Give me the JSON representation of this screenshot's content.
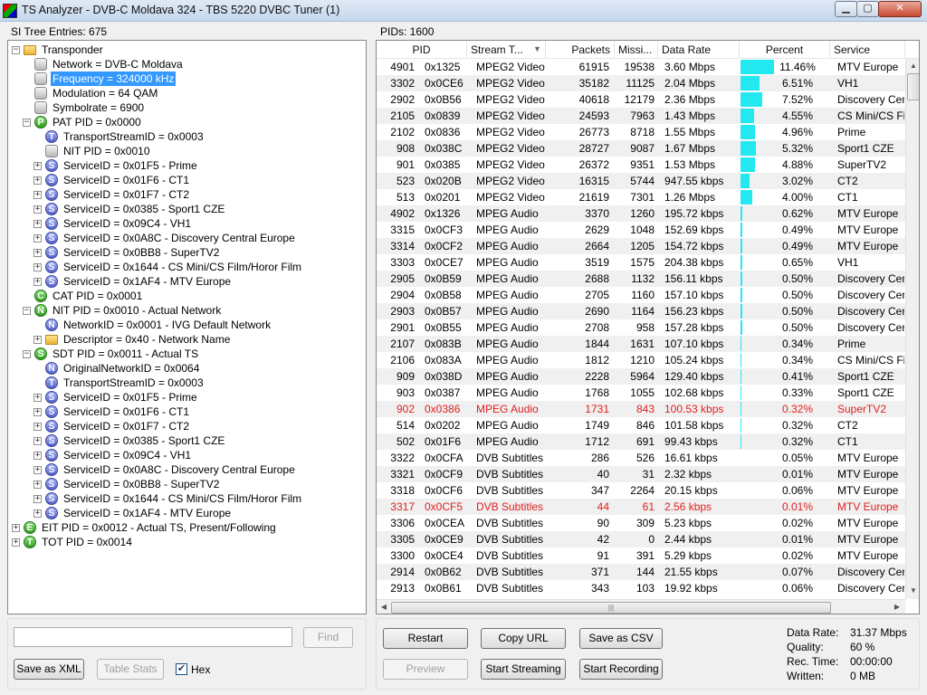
{
  "window": {
    "title": "TS Analyzer - DVB-C Moldava 324 - TBS 5220 DVBC Tuner (1)",
    "min": "▁",
    "max": "▢",
    "close": "✕"
  },
  "left": {
    "label": "SI Tree Entries: 675"
  },
  "right": {
    "label": "PIDs: 1600"
  },
  "tree": [
    {
      "lvl": 0,
      "exp": "−",
      "icon": "folder",
      "g": "",
      "text": "Transponder"
    },
    {
      "lvl": 1,
      "exp": "",
      "icon": "gray",
      "g": "",
      "text": "Network = DVB-C Moldava"
    },
    {
      "lvl": 1,
      "exp": "",
      "icon": "gray",
      "g": "",
      "text": "Frequency = 324000 kHz",
      "sel": true
    },
    {
      "lvl": 1,
      "exp": "",
      "icon": "gray",
      "g": "",
      "text": "Modulation = 64 QAM"
    },
    {
      "lvl": 1,
      "exp": "",
      "icon": "gray",
      "g": "",
      "text": "Symbolrate = 6900"
    },
    {
      "lvl": 1,
      "exp": "−",
      "icon": "green",
      "g": "P",
      "text": "PAT PID = 0x0000"
    },
    {
      "lvl": 2,
      "exp": "",
      "icon": "blue",
      "g": "T",
      "text": "TransportStreamID = 0x0003"
    },
    {
      "lvl": 2,
      "exp": "",
      "icon": "gray",
      "g": "",
      "text": "NIT PID = 0x0010"
    },
    {
      "lvl": 2,
      "exp": "+",
      "icon": "blue",
      "g": "S",
      "text": "ServiceID = 0x01F5 - Prime"
    },
    {
      "lvl": 2,
      "exp": "+",
      "icon": "blue",
      "g": "S",
      "text": "ServiceID = 0x01F6 - CT1"
    },
    {
      "lvl": 2,
      "exp": "+",
      "icon": "blue",
      "g": "S",
      "text": "ServiceID = 0x01F7 - CT2"
    },
    {
      "lvl": 2,
      "exp": "+",
      "icon": "blue",
      "g": "S",
      "text": "ServiceID = 0x0385 - Sport1 CZE"
    },
    {
      "lvl": 2,
      "exp": "+",
      "icon": "blue",
      "g": "S",
      "text": "ServiceID = 0x09C4 - VH1"
    },
    {
      "lvl": 2,
      "exp": "+",
      "icon": "blue",
      "g": "S",
      "text": "ServiceID = 0x0A8C - Discovery Central Europe"
    },
    {
      "lvl": 2,
      "exp": "+",
      "icon": "blue",
      "g": "S",
      "text": "ServiceID = 0x0BB8 - SuperTV2"
    },
    {
      "lvl": 2,
      "exp": "+",
      "icon": "blue",
      "g": "S",
      "text": "ServiceID = 0x1644 - CS Mini/CS Film/Horor Film"
    },
    {
      "lvl": 2,
      "exp": "+",
      "icon": "blue",
      "g": "S",
      "text": "ServiceID = 0x1AF4 - MTV Europe"
    },
    {
      "lvl": 1,
      "exp": "",
      "icon": "green",
      "g": "C",
      "text": "CAT PID = 0x0001"
    },
    {
      "lvl": 1,
      "exp": "−",
      "icon": "green",
      "g": "N",
      "text": "NIT PID = 0x0010 - Actual Network"
    },
    {
      "lvl": 2,
      "exp": "",
      "icon": "blue",
      "g": "N",
      "text": "NetworkID = 0x0001 - IVG Default Network"
    },
    {
      "lvl": 2,
      "exp": "+",
      "icon": "folder",
      "g": "",
      "text": "Descriptor = 0x40 - Network Name"
    },
    {
      "lvl": 1,
      "exp": "−",
      "icon": "green",
      "g": "S",
      "text": "SDT PID = 0x0011 - Actual TS"
    },
    {
      "lvl": 2,
      "exp": "",
      "icon": "blue",
      "g": "N",
      "text": "OriginalNetworkID = 0x0064"
    },
    {
      "lvl": 2,
      "exp": "",
      "icon": "blue",
      "g": "T",
      "text": "TransportStreamID = 0x0003"
    },
    {
      "lvl": 2,
      "exp": "+",
      "icon": "blue",
      "g": "S",
      "text": "ServiceID = 0x01F5 - Prime"
    },
    {
      "lvl": 2,
      "exp": "+",
      "icon": "blue",
      "g": "S",
      "text": "ServiceID = 0x01F6 - CT1"
    },
    {
      "lvl": 2,
      "exp": "+",
      "icon": "blue",
      "g": "S",
      "text": "ServiceID = 0x01F7 - CT2"
    },
    {
      "lvl": 2,
      "exp": "+",
      "icon": "blue",
      "g": "S",
      "text": "ServiceID = 0x0385 - Sport1 CZE"
    },
    {
      "lvl": 2,
      "exp": "+",
      "icon": "blue",
      "g": "S",
      "text": "ServiceID = 0x09C4 - VH1"
    },
    {
      "lvl": 2,
      "exp": "+",
      "icon": "blue",
      "g": "S",
      "text": "ServiceID = 0x0A8C - Discovery Central Europe"
    },
    {
      "lvl": 2,
      "exp": "+",
      "icon": "blue",
      "g": "S",
      "text": "ServiceID = 0x0BB8 - SuperTV2"
    },
    {
      "lvl": 2,
      "exp": "+",
      "icon": "blue",
      "g": "S",
      "text": "ServiceID = 0x1644 - CS Mini/CS Film/Horor Film"
    },
    {
      "lvl": 2,
      "exp": "+",
      "icon": "blue",
      "g": "S",
      "text": "ServiceID = 0x1AF4 - MTV Europe"
    },
    {
      "lvl": 0,
      "exp": "+",
      "icon": "green",
      "g": "E",
      "text": "EIT PID = 0x0012 - Actual TS, Present/Following"
    },
    {
      "lvl": 0,
      "exp": "+",
      "icon": "green",
      "g": "T",
      "text": "TOT PID = 0x0014"
    }
  ],
  "columns": [
    "PID",
    "Stream T...",
    "Packets",
    "Missi...",
    "Data Rate",
    "Percent",
    "Service"
  ],
  "rows": [
    {
      "pid": "4901",
      "hex": "0x1325",
      "type": "MPEG2 Video",
      "packets": "61915",
      "missing": "19538",
      "rate": "3.60 Mbps",
      "percent": "11.46%",
      "pct": 11.46,
      "service": "MTV Europe",
      "red": false
    },
    {
      "pid": "3302",
      "hex": "0x0CE6",
      "type": "MPEG2 Video",
      "packets": "35182",
      "missing": "11125",
      "rate": "2.04 Mbps",
      "percent": "6.51%",
      "pct": 6.51,
      "service": "VH1",
      "red": false
    },
    {
      "pid": "2902",
      "hex": "0x0B56",
      "type": "MPEG2 Video",
      "packets": "40618",
      "missing": "12179",
      "rate": "2.36 Mbps",
      "percent": "7.52%",
      "pct": 7.52,
      "service": "Discovery Cer",
      "red": false
    },
    {
      "pid": "2105",
      "hex": "0x0839",
      "type": "MPEG2 Video",
      "packets": "24593",
      "missing": "7963",
      "rate": "1.43 Mbps",
      "percent": "4.55%",
      "pct": 4.55,
      "service": "CS Mini/CS Fi",
      "red": false
    },
    {
      "pid": "2102",
      "hex": "0x0836",
      "type": "MPEG2 Video",
      "packets": "26773",
      "missing": "8718",
      "rate": "1.55 Mbps",
      "percent": "4.96%",
      "pct": 4.96,
      "service": "Prime",
      "red": false
    },
    {
      "pid": "908",
      "hex": "0x038C",
      "type": "MPEG2 Video",
      "packets": "28727",
      "missing": "9087",
      "rate": "1.67 Mbps",
      "percent": "5.32%",
      "pct": 5.32,
      "service": "Sport1 CZE",
      "red": false
    },
    {
      "pid": "901",
      "hex": "0x0385",
      "type": "MPEG2 Video",
      "packets": "26372",
      "missing": "9351",
      "rate": "1.53 Mbps",
      "percent": "4.88%",
      "pct": 4.88,
      "service": "SuperTV2",
      "red": false
    },
    {
      "pid": "523",
      "hex": "0x020B",
      "type": "MPEG2 Video",
      "packets": "16315",
      "missing": "5744",
      "rate": "947.55 kbps",
      "percent": "3.02%",
      "pct": 3.02,
      "service": "CT2",
      "red": false
    },
    {
      "pid": "513",
      "hex": "0x0201",
      "type": "MPEG2 Video",
      "packets": "21619",
      "missing": "7301",
      "rate": "1.26 Mbps",
      "percent": "4.00%",
      "pct": 4.0,
      "service": "CT1",
      "red": false
    },
    {
      "pid": "4902",
      "hex": "0x1326",
      "type": "MPEG Audio",
      "packets": "3370",
      "missing": "1260",
      "rate": "195.72 kbps",
      "percent": "0.62%",
      "pct": 0.62,
      "service": "MTV Europe",
      "red": false
    },
    {
      "pid": "3315",
      "hex": "0x0CF3",
      "type": "MPEG Audio",
      "packets": "2629",
      "missing": "1048",
      "rate": "152.69 kbps",
      "percent": "0.49%",
      "pct": 0.49,
      "service": "MTV Europe",
      "red": false
    },
    {
      "pid": "3314",
      "hex": "0x0CF2",
      "type": "MPEG Audio",
      "packets": "2664",
      "missing": "1205",
      "rate": "154.72 kbps",
      "percent": "0.49%",
      "pct": 0.49,
      "service": "MTV Europe",
      "red": false
    },
    {
      "pid": "3303",
      "hex": "0x0CE7",
      "type": "MPEG Audio",
      "packets": "3519",
      "missing": "1575",
      "rate": "204.38 kbps",
      "percent": "0.65%",
      "pct": 0.65,
      "service": "VH1",
      "red": false
    },
    {
      "pid": "2905",
      "hex": "0x0B59",
      "type": "MPEG Audio",
      "packets": "2688",
      "missing": "1132",
      "rate": "156.11 kbps",
      "percent": "0.50%",
      "pct": 0.5,
      "service": "Discovery Cer",
      "red": false
    },
    {
      "pid": "2904",
      "hex": "0x0B58",
      "type": "MPEG Audio",
      "packets": "2705",
      "missing": "1160",
      "rate": "157.10 kbps",
      "percent": "0.50%",
      "pct": 0.5,
      "service": "Discovery Cer",
      "red": false
    },
    {
      "pid": "2903",
      "hex": "0x0B57",
      "type": "MPEG Audio",
      "packets": "2690",
      "missing": "1164",
      "rate": "156.23 kbps",
      "percent": "0.50%",
      "pct": 0.5,
      "service": "Discovery Cer",
      "red": false
    },
    {
      "pid": "2901",
      "hex": "0x0B55",
      "type": "MPEG Audio",
      "packets": "2708",
      "missing": "958",
      "rate": "157.28 kbps",
      "percent": "0.50%",
      "pct": 0.5,
      "service": "Discovery Cer",
      "red": false
    },
    {
      "pid": "2107",
      "hex": "0x083B",
      "type": "MPEG Audio",
      "packets": "1844",
      "missing": "1631",
      "rate": "107.10 kbps",
      "percent": "0.34%",
      "pct": 0.34,
      "service": "Prime",
      "red": false
    },
    {
      "pid": "2106",
      "hex": "0x083A",
      "type": "MPEG Audio",
      "packets": "1812",
      "missing": "1210",
      "rate": "105.24 kbps",
      "percent": "0.34%",
      "pct": 0.34,
      "service": "CS Mini/CS Fi",
      "red": false
    },
    {
      "pid": "909",
      "hex": "0x038D",
      "type": "MPEG Audio",
      "packets": "2228",
      "missing": "5964",
      "rate": "129.40 kbps",
      "percent": "0.41%",
      "pct": 0.41,
      "service": "Sport1 CZE",
      "red": false
    },
    {
      "pid": "903",
      "hex": "0x0387",
      "type": "MPEG Audio",
      "packets": "1768",
      "missing": "1055",
      "rate": "102.68 kbps",
      "percent": "0.33%",
      "pct": 0.33,
      "service": "Sport1 CZE",
      "red": false
    },
    {
      "pid": "902",
      "hex": "0x0386",
      "type": "MPEG Audio",
      "packets": "1731",
      "missing": "843",
      "rate": "100.53 kbps",
      "percent": "0.32%",
      "pct": 0.32,
      "service": "SuperTV2",
      "red": true
    },
    {
      "pid": "514",
      "hex": "0x0202",
      "type": "MPEG Audio",
      "packets": "1749",
      "missing": "846",
      "rate": "101.58 kbps",
      "percent": "0.32%",
      "pct": 0.32,
      "service": "CT2",
      "red": false
    },
    {
      "pid": "502",
      "hex": "0x01F6",
      "type": "MPEG Audio",
      "packets": "1712",
      "missing": "691",
      "rate": "99.43 kbps",
      "percent": "0.32%",
      "pct": 0.32,
      "service": "CT1",
      "red": false
    },
    {
      "pid": "3322",
      "hex": "0x0CFA",
      "type": "DVB Subtitles",
      "packets": "286",
      "missing": "526",
      "rate": "16.61 kbps",
      "percent": "0.05%",
      "pct": 0.05,
      "service": "MTV Europe",
      "red": false
    },
    {
      "pid": "3321",
      "hex": "0x0CF9",
      "type": "DVB Subtitles",
      "packets": "40",
      "missing": "31",
      "rate": "2.32 kbps",
      "percent": "0.01%",
      "pct": 0.01,
      "service": "MTV Europe",
      "red": false
    },
    {
      "pid": "3318",
      "hex": "0x0CF6",
      "type": "DVB Subtitles",
      "packets": "347",
      "missing": "2264",
      "rate": "20.15 kbps",
      "percent": "0.06%",
      "pct": 0.06,
      "service": "MTV Europe",
      "red": false
    },
    {
      "pid": "3317",
      "hex": "0x0CF5",
      "type": "DVB Subtitles",
      "packets": "44",
      "missing": "61",
      "rate": "2.56 kbps",
      "percent": "0.01%",
      "pct": 0.01,
      "service": "MTV Europe",
      "red": true
    },
    {
      "pid": "3306",
      "hex": "0x0CEA",
      "type": "DVB Subtitles",
      "packets": "90",
      "missing": "309",
      "rate": "5.23 kbps",
      "percent": "0.02%",
      "pct": 0.02,
      "service": "MTV Europe",
      "red": false
    },
    {
      "pid": "3305",
      "hex": "0x0CE9",
      "type": "DVB Subtitles",
      "packets": "42",
      "missing": "0",
      "rate": "2.44 kbps",
      "percent": "0.01%",
      "pct": 0.01,
      "service": "MTV Europe",
      "red": false
    },
    {
      "pid": "3300",
      "hex": "0x0CE4",
      "type": "DVB Subtitles",
      "packets": "91",
      "missing": "391",
      "rate": "5.29 kbps",
      "percent": "0.02%",
      "pct": 0.02,
      "service": "MTV Europe",
      "red": false
    },
    {
      "pid": "2914",
      "hex": "0x0B62",
      "type": "DVB Subtitles",
      "packets": "371",
      "missing": "144",
      "rate": "21.55 kbps",
      "percent": "0.07%",
      "pct": 0.07,
      "service": "Discovery Cer",
      "red": false
    },
    {
      "pid": "2913",
      "hex": "0x0B61",
      "type": "DVB Subtitles",
      "packets": "343",
      "missing": "103",
      "rate": "19.92 kbps",
      "percent": "0.06%",
      "pct": 0.06,
      "service": "Discovery Cer",
      "red": false
    }
  ],
  "controls": {
    "search_placeholder": "",
    "find": "Find",
    "save_xml": "Save as XML",
    "table_stats": "Table Stats",
    "hex": "Hex",
    "hex_checked": "✔",
    "restart": "Restart",
    "copy_url": "Copy URL",
    "save_csv": "Save as CSV",
    "preview": "Preview",
    "start_streaming": "Start Streaming",
    "start_recording": "Start Recording"
  },
  "stats": {
    "data_rate_label": "Data Rate:",
    "data_rate": "31.37 Mbps",
    "quality_label": "Quality:",
    "quality": "60 %",
    "rec_time_label": "Rec. Time:",
    "rec_time": "00:00:00",
    "written_label": "Written:",
    "written": "0 MB"
  },
  "colors": {
    "percent_bar": "#22e8f0",
    "error_text": "#e02020",
    "selection": "#3399ff"
  }
}
